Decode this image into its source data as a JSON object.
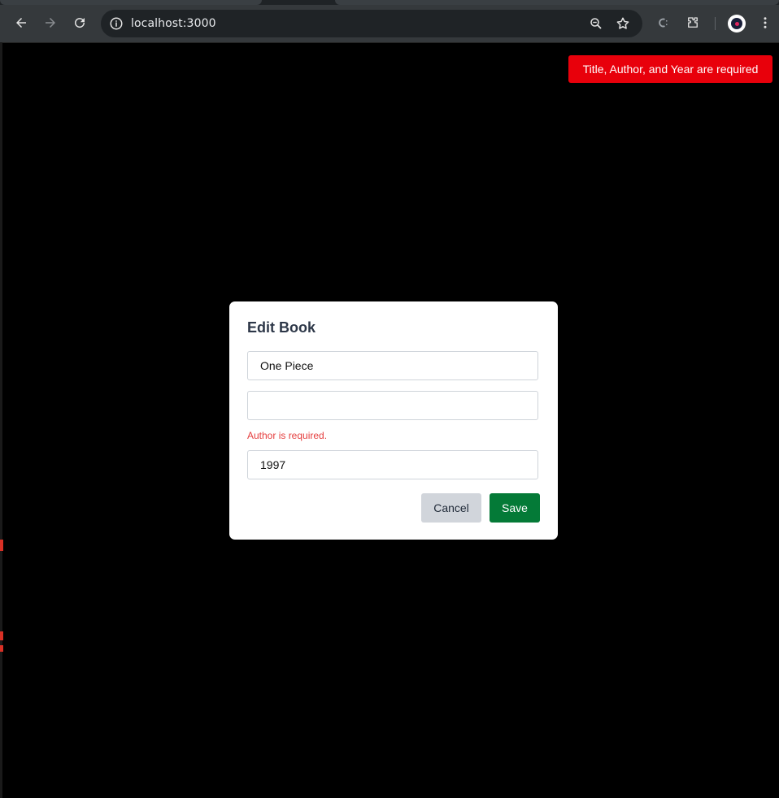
{
  "browser": {
    "url": "localhost:3000"
  },
  "toast": {
    "message": "Title, Author, and Year are required",
    "color": "#e8000b"
  },
  "modal": {
    "title": "Edit Book",
    "fields": {
      "title": {
        "value": "One Piece",
        "placeholder": ""
      },
      "author": {
        "value": "",
        "placeholder": ""
      },
      "year": {
        "value": "1997",
        "placeholder": ""
      }
    },
    "author_error": "Author is required.",
    "cancel_label": "Cancel",
    "save_label": "Save"
  },
  "colors": {
    "save_button": "#047a37",
    "cancel_button": "#d1d5db",
    "error_text": "#e53e3e"
  }
}
